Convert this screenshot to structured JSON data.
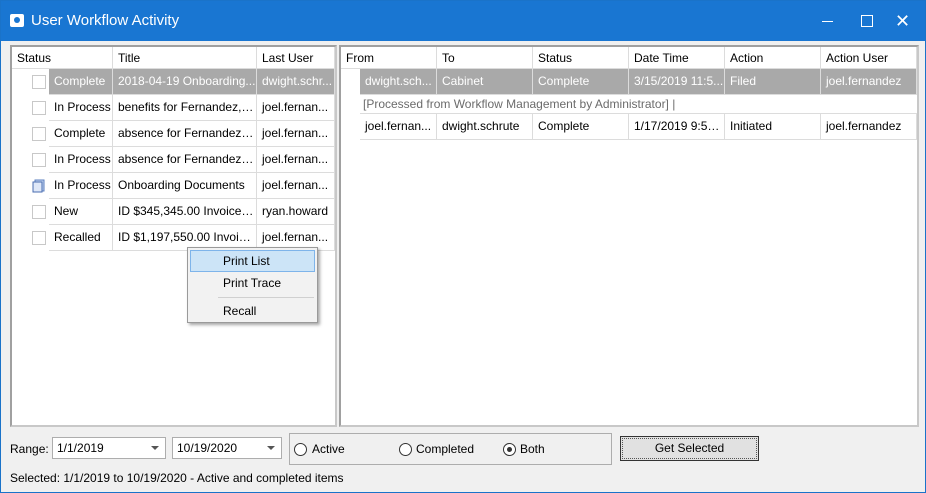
{
  "window": {
    "title": "User Workflow Activity",
    "minimize_icon": "minimize-icon",
    "maximize_icon": "maximize-icon",
    "close_icon": "close-icon",
    "close_glyph": "✕",
    "accent": "#1976d2"
  },
  "left_grid": {
    "headers": [
      "Status",
      "Title",
      "Last User"
    ],
    "rows": [
      {
        "status": "Complete",
        "title": "2018-04-19 Onboarding...",
        "last_user": "dwight.schr...",
        "icon": "checkbox"
      },
      {
        "status": "In Process",
        "title": "benefits for Fernandez, J...",
        "last_user": "joel.fernan...",
        "icon": "checkbox"
      },
      {
        "status": "Complete",
        "title": "absence for Fernandez, ...",
        "last_user": "joel.fernan...",
        "icon": "checkbox"
      },
      {
        "status": "In Process",
        "title": "absence for Fernandez, ...",
        "last_user": "joel.fernan...",
        "icon": "checkbox"
      },
      {
        "status": "In Process",
        "title": "Onboarding Documents",
        "last_user": "joel.fernan...",
        "icon": "note-icon"
      },
      {
        "status": "New",
        "title": "ID $345,345.00 Invoice T...",
        "last_user": "ryan.howard",
        "icon": "checkbox"
      },
      {
        "status": "Recalled",
        "title": "ID $1,197,550.00 Invoice ...",
        "last_user": "joel.fernan...",
        "icon": "checkbox"
      }
    ]
  },
  "right_grid": {
    "headers": [
      "From",
      "To",
      "Status",
      "Date Time",
      "Action",
      "Action User"
    ],
    "rows": [
      {
        "from": "dwight.sch...",
        "to": "Cabinet",
        "status": "Complete",
        "date_time": "3/15/2019 11:5...",
        "action": "Filed",
        "action_user": "joel.fernandez"
      },
      {
        "from": "joel.fernan...",
        "to": "dwight.schrute",
        "status": "Complete",
        "date_time": "1/17/2019 9:50:...",
        "action": "Initiated",
        "action_user": "joel.fernandez"
      }
    ],
    "note": "[Processed from Workflow Management by Administrator]  |"
  },
  "context_menu": {
    "items": [
      "Print List",
      "Print Trace",
      "Recall"
    ]
  },
  "filters": {
    "range_label": "Range:",
    "start_date": "1/1/2019",
    "end_date": "10/19/2020",
    "radio_options": [
      "Active",
      "Completed",
      "Both"
    ],
    "selected_option": "Both",
    "get_selected_label": "Get Selected"
  },
  "status_bar": {
    "text": "Selected: 1/1/2019 to 10/19/2020 - Active and completed items"
  }
}
